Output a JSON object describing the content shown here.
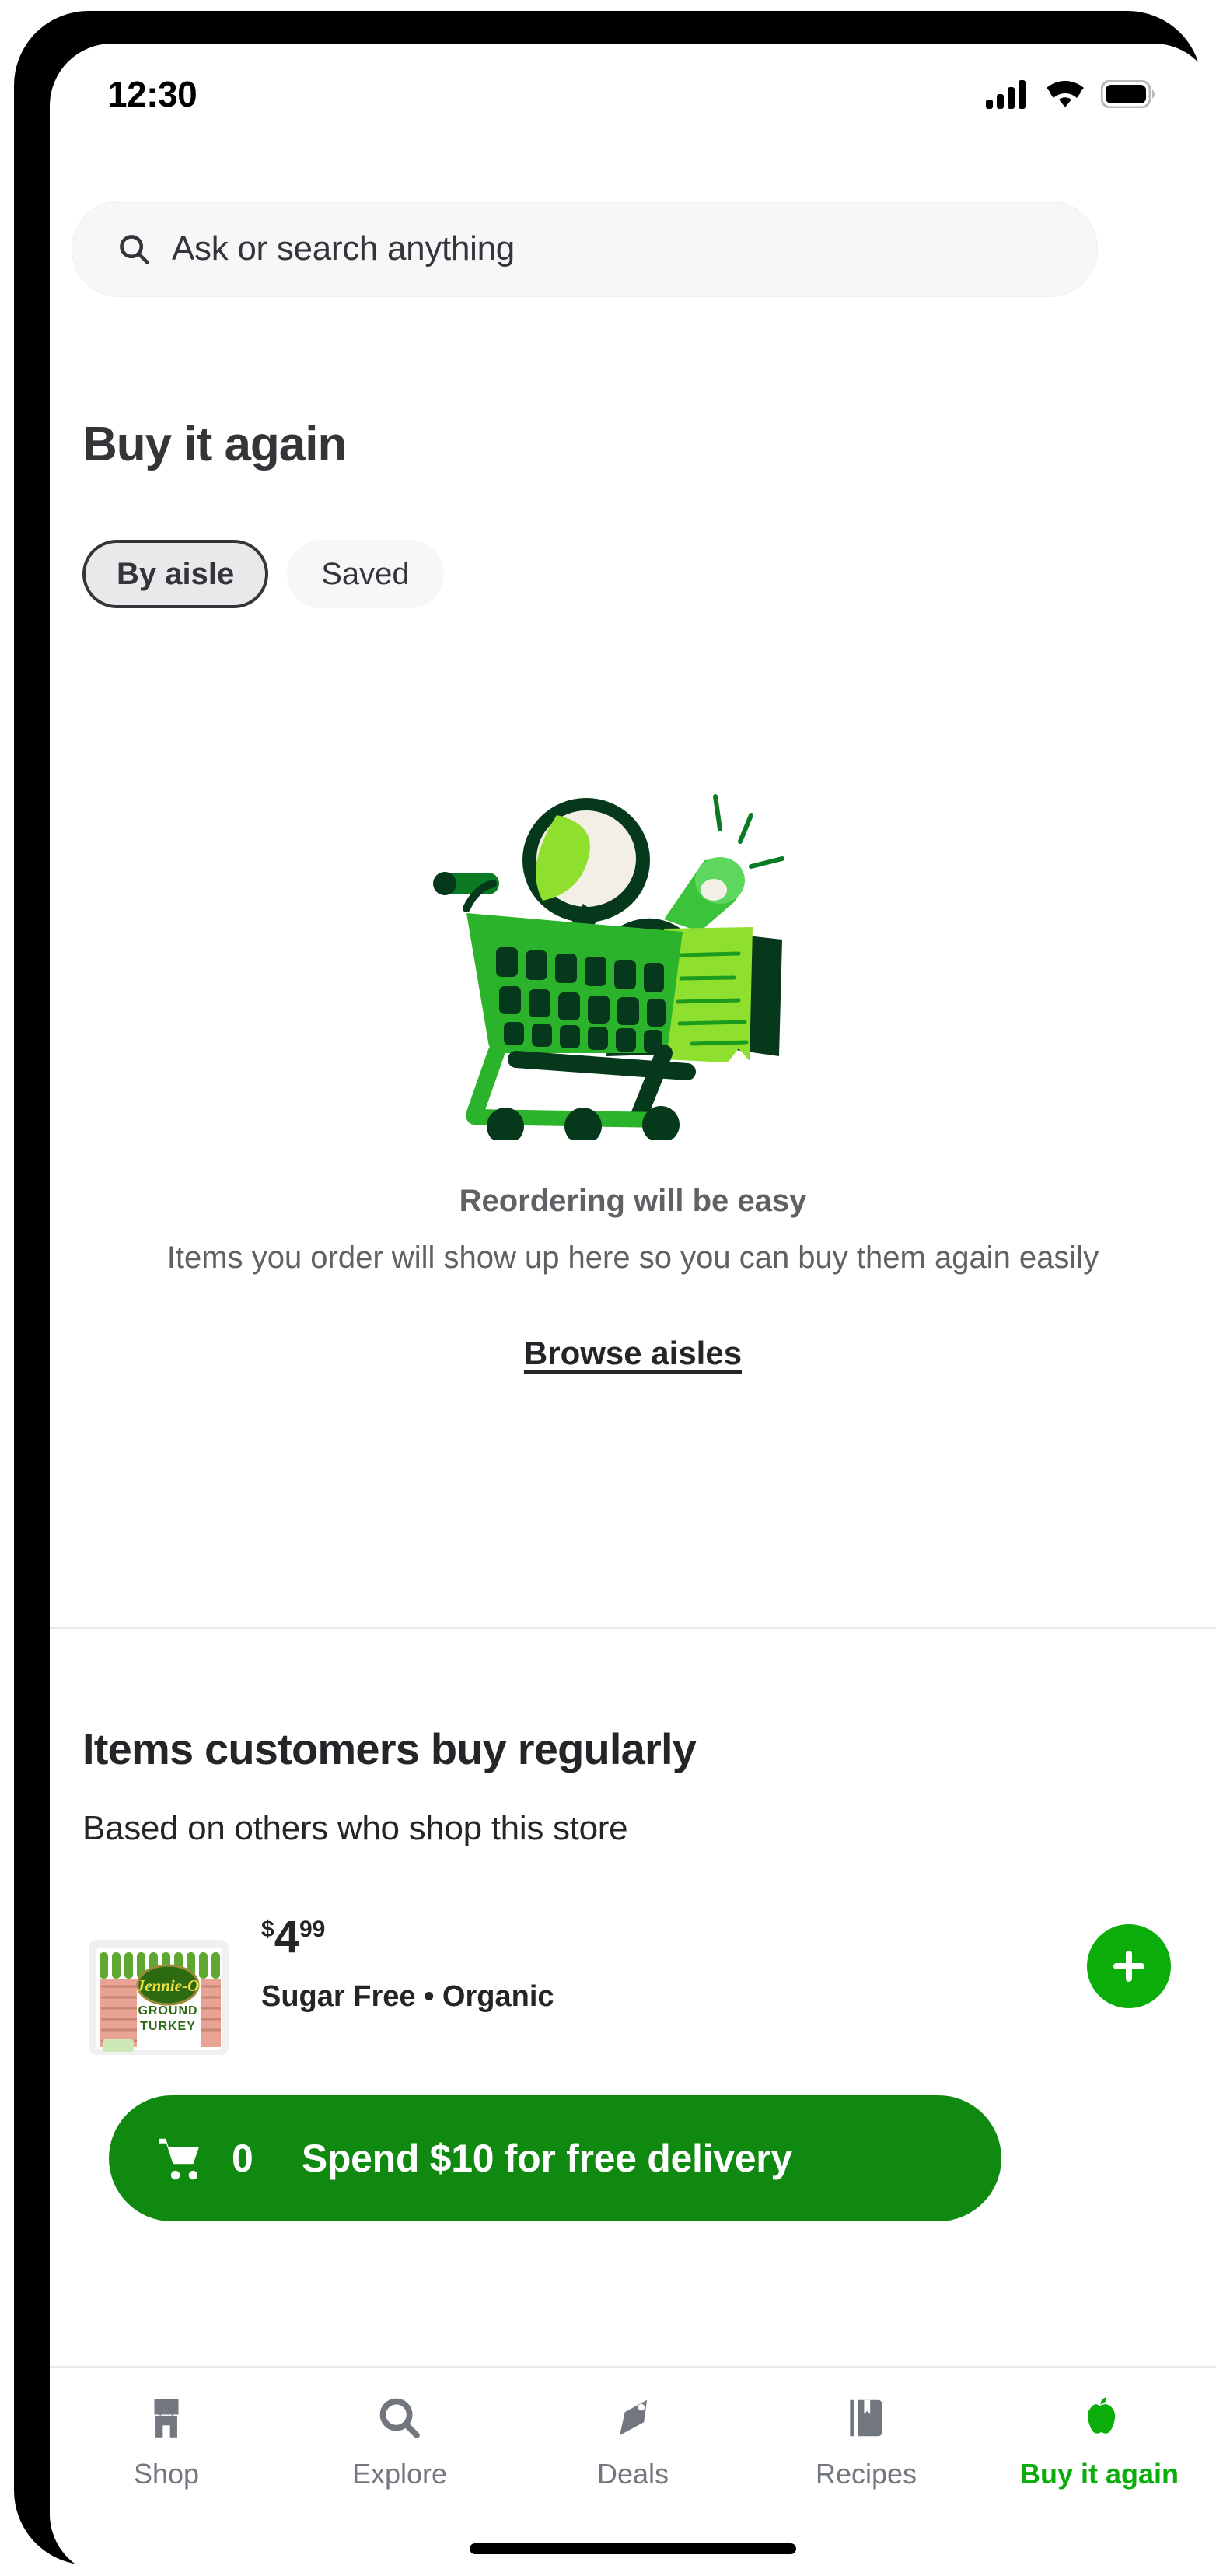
{
  "status_bar": {
    "time": "12:30",
    "icons": [
      "cellular-signal-icon",
      "wifi-icon",
      "battery-icon"
    ],
    "battery_level": "full",
    "signal_bars": 4
  },
  "search": {
    "placeholder": "Ask or search anything",
    "value": "",
    "icon": "search-icon"
  },
  "header": {
    "title": "Buy it again"
  },
  "filter_chips": [
    {
      "label": "By aisle",
      "selected": true
    },
    {
      "label": "Saved",
      "selected": false
    }
  ],
  "empty_state": {
    "illustration": "shopping-cart-with-magnifier-megaphone-and-receipt-illustration",
    "title": "Reordering will be easy",
    "description": "Items you order will show up here so you can buy them again easily",
    "link_label": "Browse aisles"
  },
  "regular_items": {
    "title": "Items customers buy regularly",
    "subtitle": "Based on others who shop this store",
    "products": [
      {
        "image": "jennie-o-ground-turkey-package",
        "brand_on_package": "Jennie-O",
        "package_text": "GROUND TURKEY",
        "price_dollar_symbol": "$",
        "price_whole": "4",
        "price_cents": "99",
        "attributes": "Sugar Free • Organic",
        "add_button_label": "+"
      }
    ]
  },
  "cart_banner": {
    "icon": "shopping-cart-icon",
    "count": "0",
    "message": "Spend $10 for free delivery"
  },
  "bottom_nav": [
    {
      "label": "Shop",
      "icon": "storefront-icon",
      "active": false
    },
    {
      "label": "Explore",
      "icon": "search-icon",
      "active": false
    },
    {
      "label": "Deals",
      "icon": "tag-icon",
      "active": false
    },
    {
      "label": "Recipes",
      "icon": "book-icon",
      "active": false
    },
    {
      "label": "Buy it again",
      "icon": "apple-icon",
      "active": true
    }
  ],
  "colors": {
    "brand_green": "#0aad0a",
    "banner_green": "#108910",
    "text_primary": "#242529",
    "text_secondary": "#606165",
    "nav_inactive": "#72767e",
    "chip_selected_bg": "#e8e9eb",
    "chip_unselected_bg": "#f6f7f8",
    "search_bg": "#f6f7f8"
  }
}
